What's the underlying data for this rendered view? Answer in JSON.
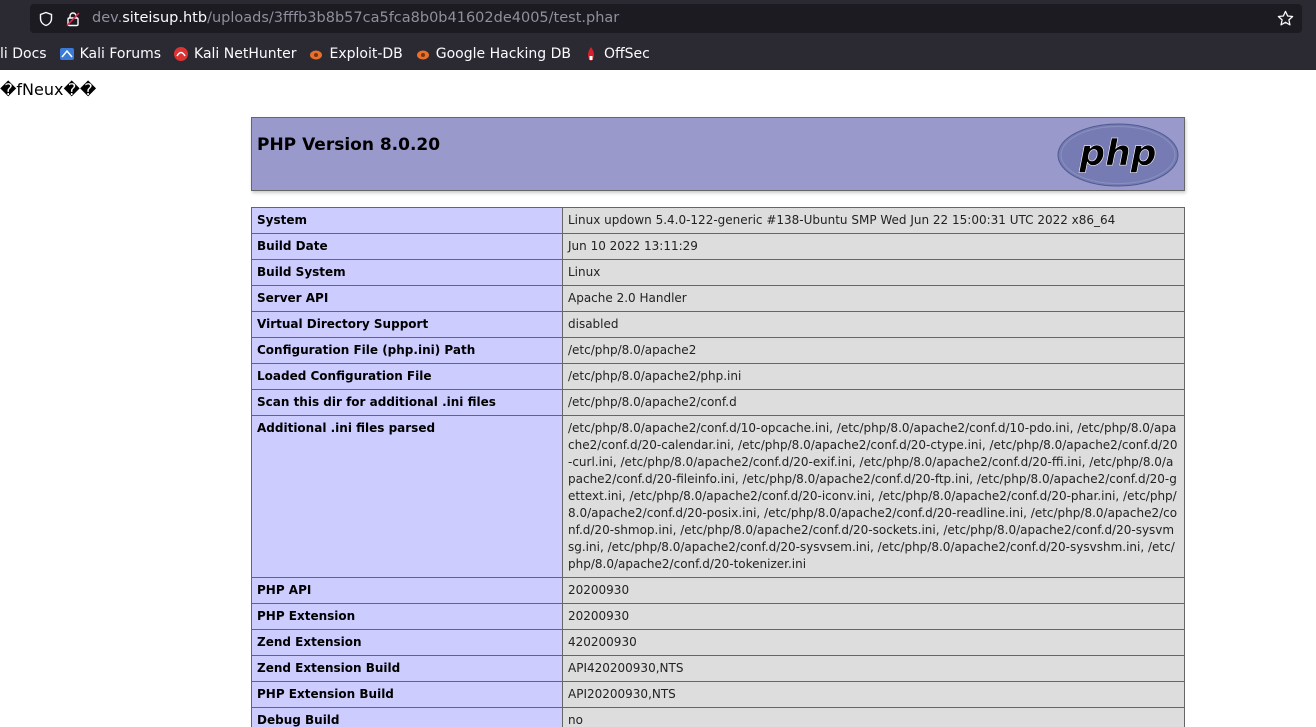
{
  "browser": {
    "url_prefix": "dev.",
    "url_domain": "siteisup.htb",
    "url_path": "/uploads/3fffb3b8b57ca5fca8b0b41602de4005/test.phar",
    "bookmarks": [
      {
        "label": "li Docs",
        "icon": "none"
      },
      {
        "label": "Kali Forums",
        "icon": "kali-forums-icon"
      },
      {
        "label": "Kali NetHunter",
        "icon": "nethunter-icon"
      },
      {
        "label": "Exploit-DB",
        "icon": "exploitdb-icon"
      },
      {
        "label": "Google Hacking DB",
        "icon": "ghdb-icon"
      },
      {
        "label": "OffSec",
        "icon": "offsec-icon"
      }
    ]
  },
  "page": {
    "garbage_text": "�fNeux��",
    "php_version_title": "PHP Version 8.0.20",
    "logo_text": "php",
    "rows": [
      {
        "key": "System",
        "value": "Linux updown 5.4.0-122-generic #138-Ubuntu SMP Wed Jun 22 15:00:31 UTC 2022 x86_64"
      },
      {
        "key": "Build Date",
        "value": "Jun 10 2022 13:11:29"
      },
      {
        "key": "Build System",
        "value": "Linux"
      },
      {
        "key": "Server API",
        "value": "Apache 2.0 Handler"
      },
      {
        "key": "Virtual Directory Support",
        "value": "disabled"
      },
      {
        "key": "Configuration File (php.ini) Path",
        "value": "/etc/php/8.0/apache2"
      },
      {
        "key": "Loaded Configuration File",
        "value": "/etc/php/8.0/apache2/php.ini"
      },
      {
        "key": "Scan this dir for additional .ini files",
        "value": "/etc/php/8.0/apache2/conf.d"
      },
      {
        "key": "Additional .ini files parsed",
        "value": "/etc/php/8.0/apache2/conf.d/10-opcache.ini, /etc/php/8.0/apache2/conf.d/10-pdo.ini, /etc/php/8.0/apache2/conf.d/20-calendar.ini, /etc/php/8.0/apache2/conf.d/20-ctype.ini, /etc/php/8.0/apache2/conf.d/20-curl.ini, /etc/php/8.0/apache2/conf.d/20-exif.ini, /etc/php/8.0/apache2/conf.d/20-ffi.ini, /etc/php/8.0/apache2/conf.d/20-fileinfo.ini, /etc/php/8.0/apache2/conf.d/20-ftp.ini, /etc/php/8.0/apache2/conf.d/20-gettext.ini, /etc/php/8.0/apache2/conf.d/20-iconv.ini, /etc/php/8.0/apache2/conf.d/20-phar.ini, /etc/php/8.0/apache2/conf.d/20-posix.ini, /etc/php/8.0/apache2/conf.d/20-readline.ini, /etc/php/8.0/apache2/conf.d/20-shmop.ini, /etc/php/8.0/apache2/conf.d/20-sockets.ini, /etc/php/8.0/apache2/conf.d/20-sysvmsg.ini, /etc/php/8.0/apache2/conf.d/20-sysvsem.ini, /etc/php/8.0/apache2/conf.d/20-sysvshm.ini, /etc/php/8.0/apache2/conf.d/20-tokenizer.ini"
      },
      {
        "key": "PHP API",
        "value": "20200930"
      },
      {
        "key": "PHP Extension",
        "value": "20200930"
      },
      {
        "key": "Zend Extension",
        "value": "420200930"
      },
      {
        "key": "Zend Extension Build",
        "value": "API420200930,NTS"
      },
      {
        "key": "PHP Extension Build",
        "value": "API20200930,NTS"
      },
      {
        "key": "Debug Build",
        "value": "no"
      }
    ]
  }
}
